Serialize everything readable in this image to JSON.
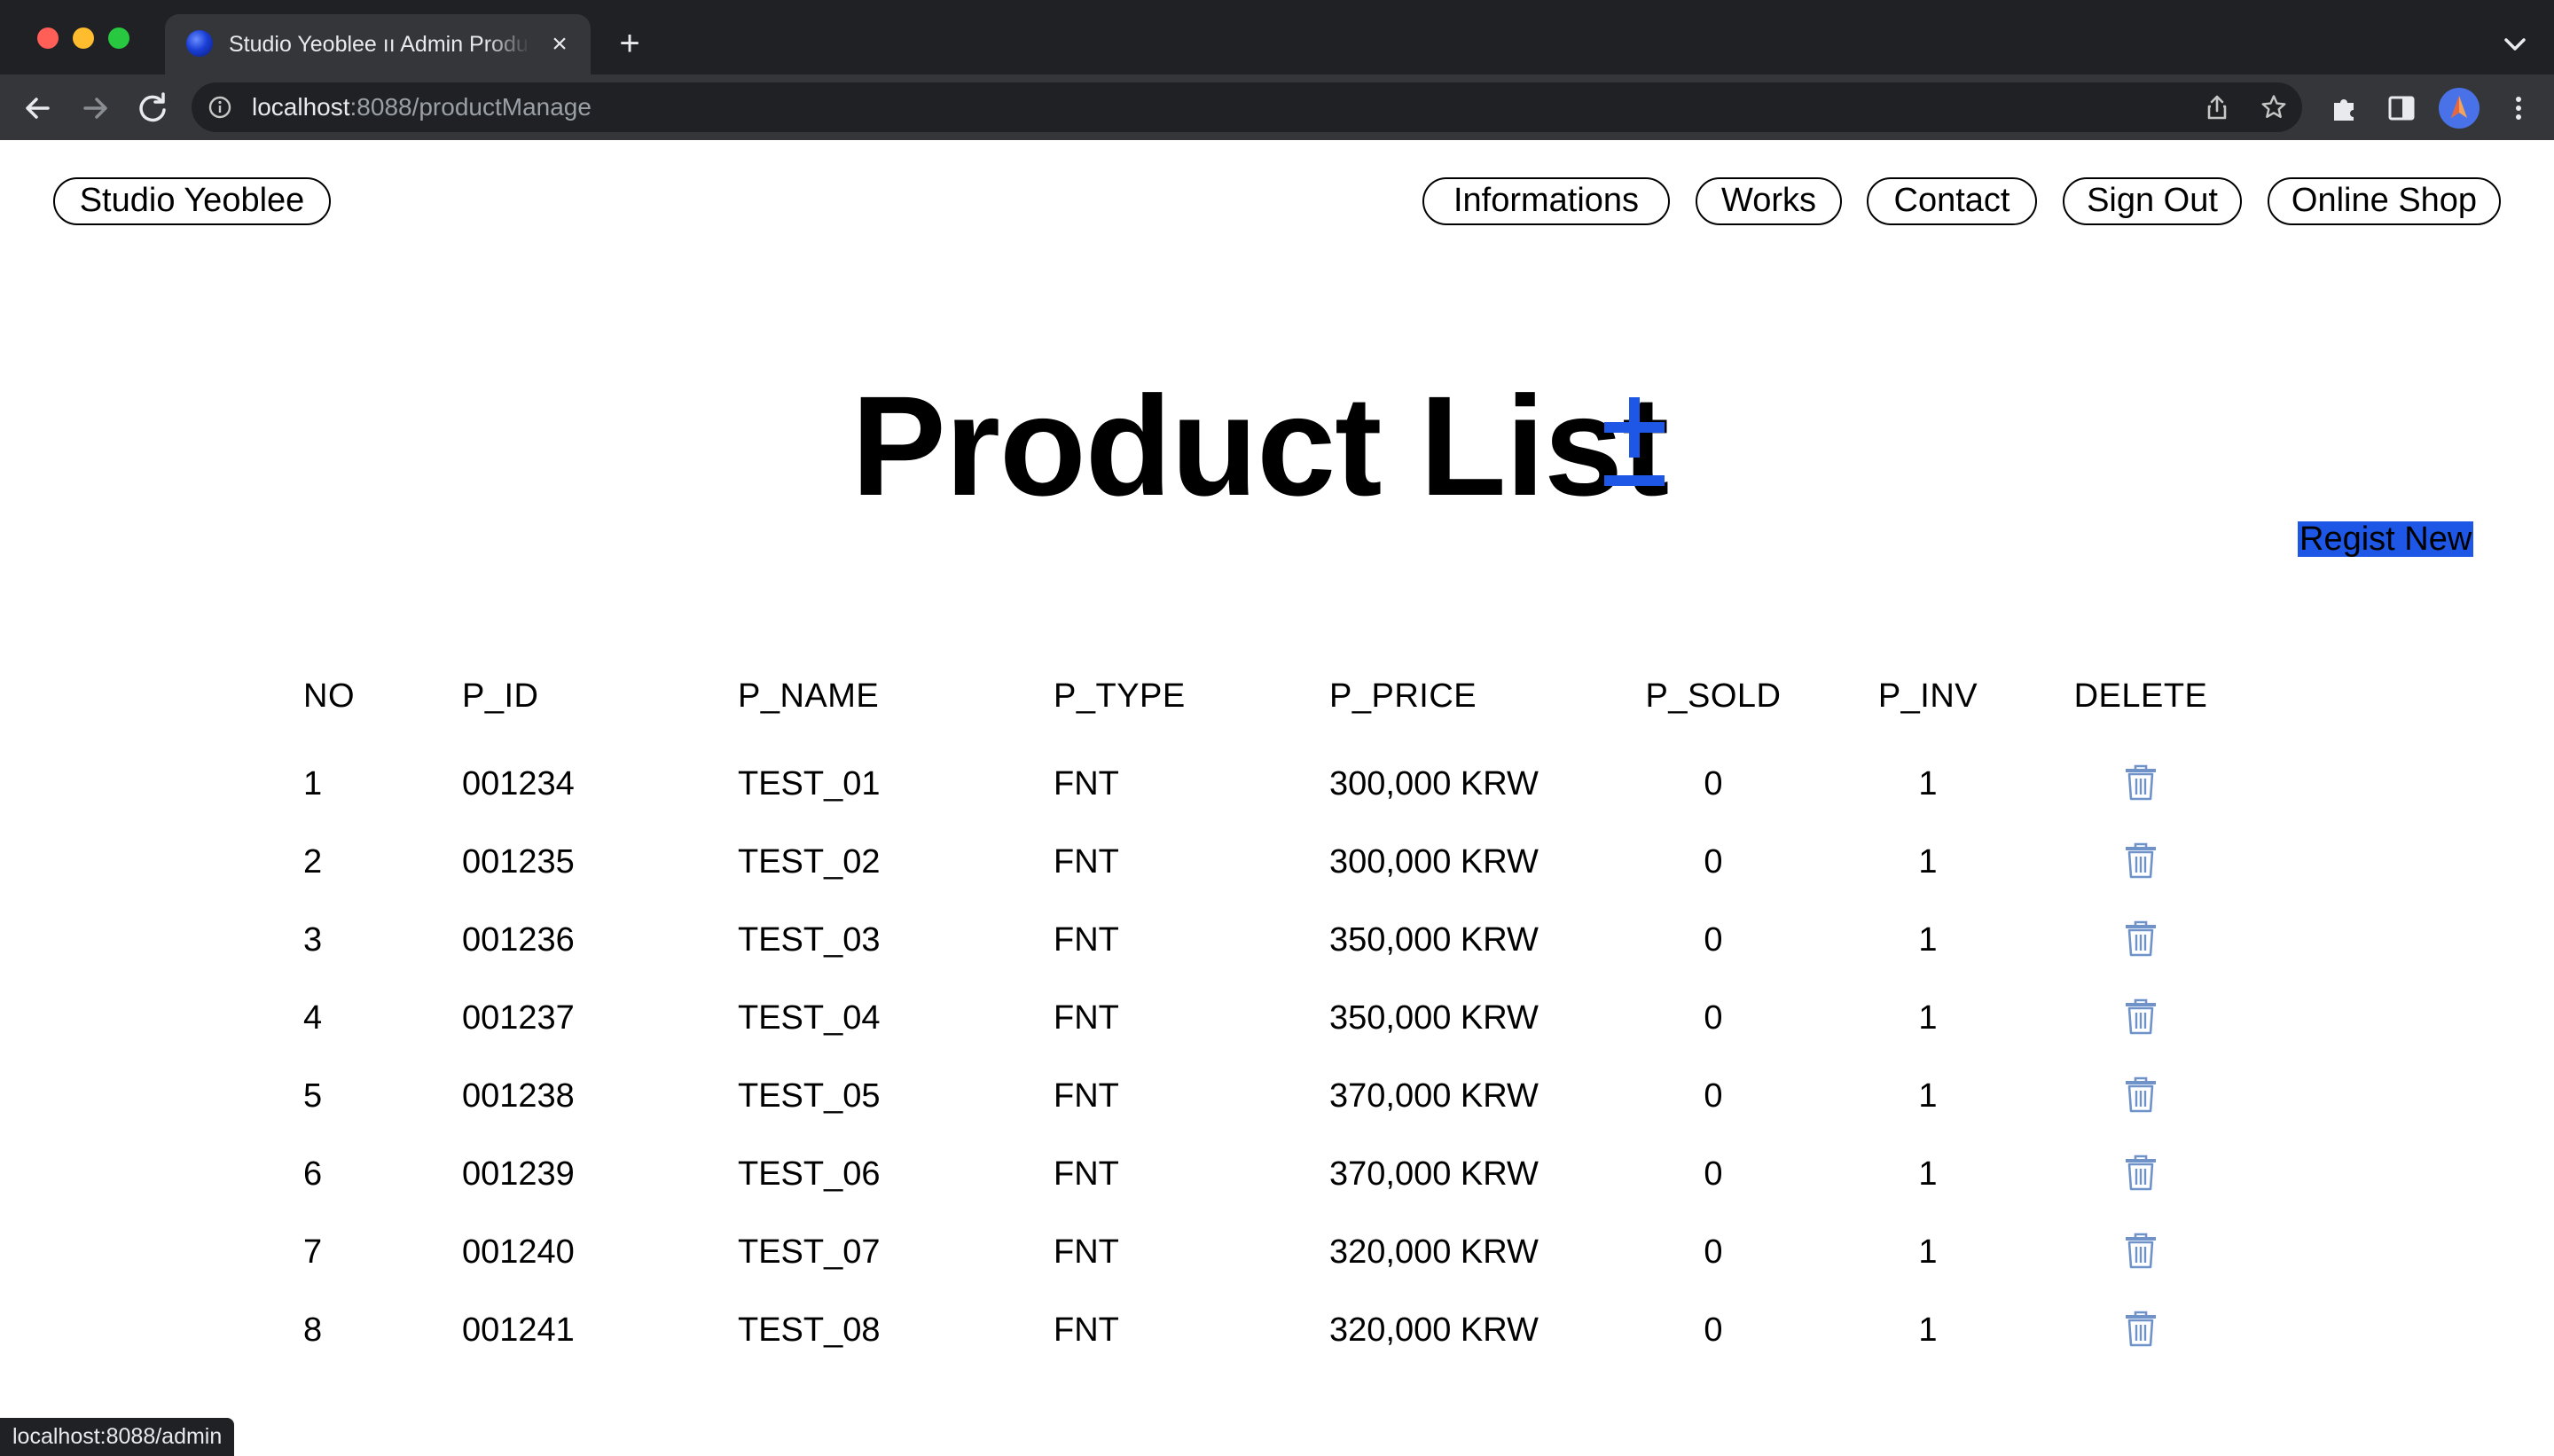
{
  "browser": {
    "tab_title": "Studio Yeoblee ıı Admin Product Manage",
    "tab_close": "×",
    "new_tab": "+",
    "url_host": "localhost",
    "url_path": ":8088/productManage",
    "status_url": "localhost:8088/admin"
  },
  "nav": {
    "brand": "Studio Yeoblee",
    "items": [
      "Informations",
      "Works",
      "Contact",
      "Sign Out",
      "Online Shop"
    ]
  },
  "main": {
    "title": "Product List",
    "add_icon": "plus-minus-icon",
    "regist_label": "Regist New"
  },
  "table": {
    "columns": [
      "NO",
      "P_ID",
      "P_NAME",
      "P_TYPE",
      "P_PRICE",
      "P_SOLD",
      "P_INV",
      "DELETE"
    ],
    "rows": [
      {
        "no": "1",
        "p_id": "001234",
        "p_name": "TEST_01",
        "p_type": "FNT",
        "p_price": "300,000 KRW",
        "p_sold": "0",
        "p_inv": "1"
      },
      {
        "no": "2",
        "p_id": "001235",
        "p_name": "TEST_02",
        "p_type": "FNT",
        "p_price": "300,000 KRW",
        "p_sold": "0",
        "p_inv": "1"
      },
      {
        "no": "3",
        "p_id": "001236",
        "p_name": "TEST_03",
        "p_type": "FNT",
        "p_price": "350,000 KRW",
        "p_sold": "0",
        "p_inv": "1"
      },
      {
        "no": "4",
        "p_id": "001237",
        "p_name": "TEST_04",
        "p_type": "FNT",
        "p_price": "350,000 KRW",
        "p_sold": "0",
        "p_inv": "1"
      },
      {
        "no": "5",
        "p_id": "001238",
        "p_name": "TEST_05",
        "p_type": "FNT",
        "p_price": "370,000 KRW",
        "p_sold": "0",
        "p_inv": "1"
      },
      {
        "no": "6",
        "p_id": "001239",
        "p_name": "TEST_06",
        "p_type": "FNT",
        "p_price": "370,000 KRW",
        "p_sold": "0",
        "p_inv": "1"
      },
      {
        "no": "7",
        "p_id": "001240",
        "p_name": "TEST_07",
        "p_type": "FNT",
        "p_price": "320,000 KRW",
        "p_sold": "0",
        "p_inv": "1"
      },
      {
        "no": "8",
        "p_id": "001241",
        "p_name": "TEST_08",
        "p_type": "FNT",
        "p_price": "320,000 KRW",
        "p_sold": "0",
        "p_inv": "1"
      }
    ],
    "delete_icon": "trash-icon"
  },
  "colors": {
    "accent": "#1e57e6",
    "trash": "#6f93c9",
    "chrome_dark": "#202124",
    "chrome_toolbar": "#35363a"
  }
}
